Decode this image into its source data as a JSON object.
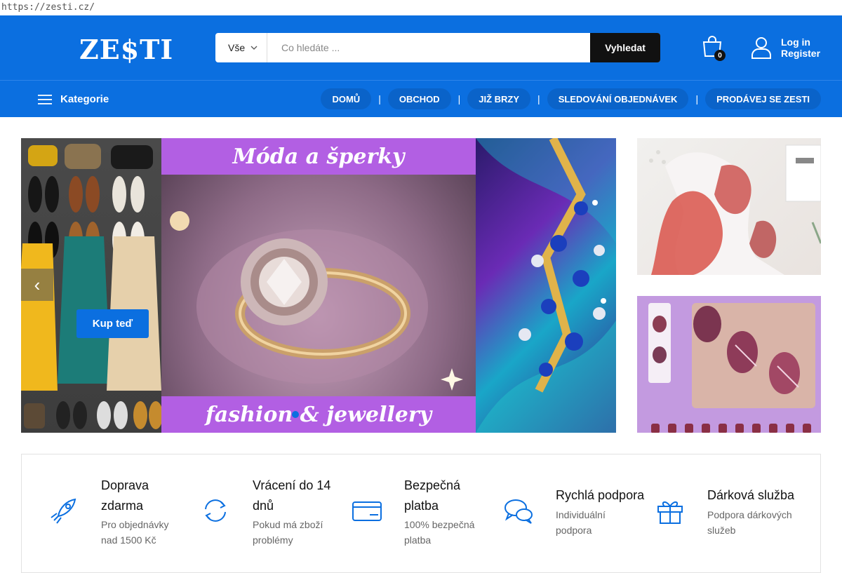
{
  "browser": {
    "url": "https://zesti.cz/"
  },
  "header": {
    "logo": "ZE$TI",
    "search": {
      "category": "Vše",
      "placeholder": "Co hledáte ...",
      "button": "Vyhledat"
    },
    "cart_count": "0",
    "login": "Log in",
    "register": "Register"
  },
  "nav": {
    "categories_label": "Kategorie",
    "items": [
      "DOMŮ",
      "OBCHOD",
      "JIŽ BRZY",
      "SLEDOVÁNÍ OBJEDNÁVEK",
      "PRODÁVEJ SE ZESTI"
    ]
  },
  "slider": {
    "title": "Móda a šperky",
    "subtitle": "fashion & jewellery",
    "cta": "Kup teď"
  },
  "features": [
    {
      "title": "Doprava zdarma",
      "desc": "Pro objednávky nad 1500 Kč",
      "icon": "rocket-icon"
    },
    {
      "title": "Vrácení do 14 dnů",
      "desc": "Pokud má zboží problémy",
      "icon": "refresh-icon"
    },
    {
      "title": "Bezpečná platba",
      "desc": "100% bezpečná platba",
      "icon": "credit-card-icon"
    },
    {
      "title": "Rychlá podpora",
      "desc": "Individuální podpora",
      "icon": "chat-icon"
    },
    {
      "title": "Dárková služba",
      "desc": "Podpora dárkových služeb",
      "icon": "gift-icon"
    }
  ],
  "colors": {
    "brand_blue": "#0b6fe0",
    "search_button": "#111111",
    "ribbon_purple": "#b25fe3"
  }
}
